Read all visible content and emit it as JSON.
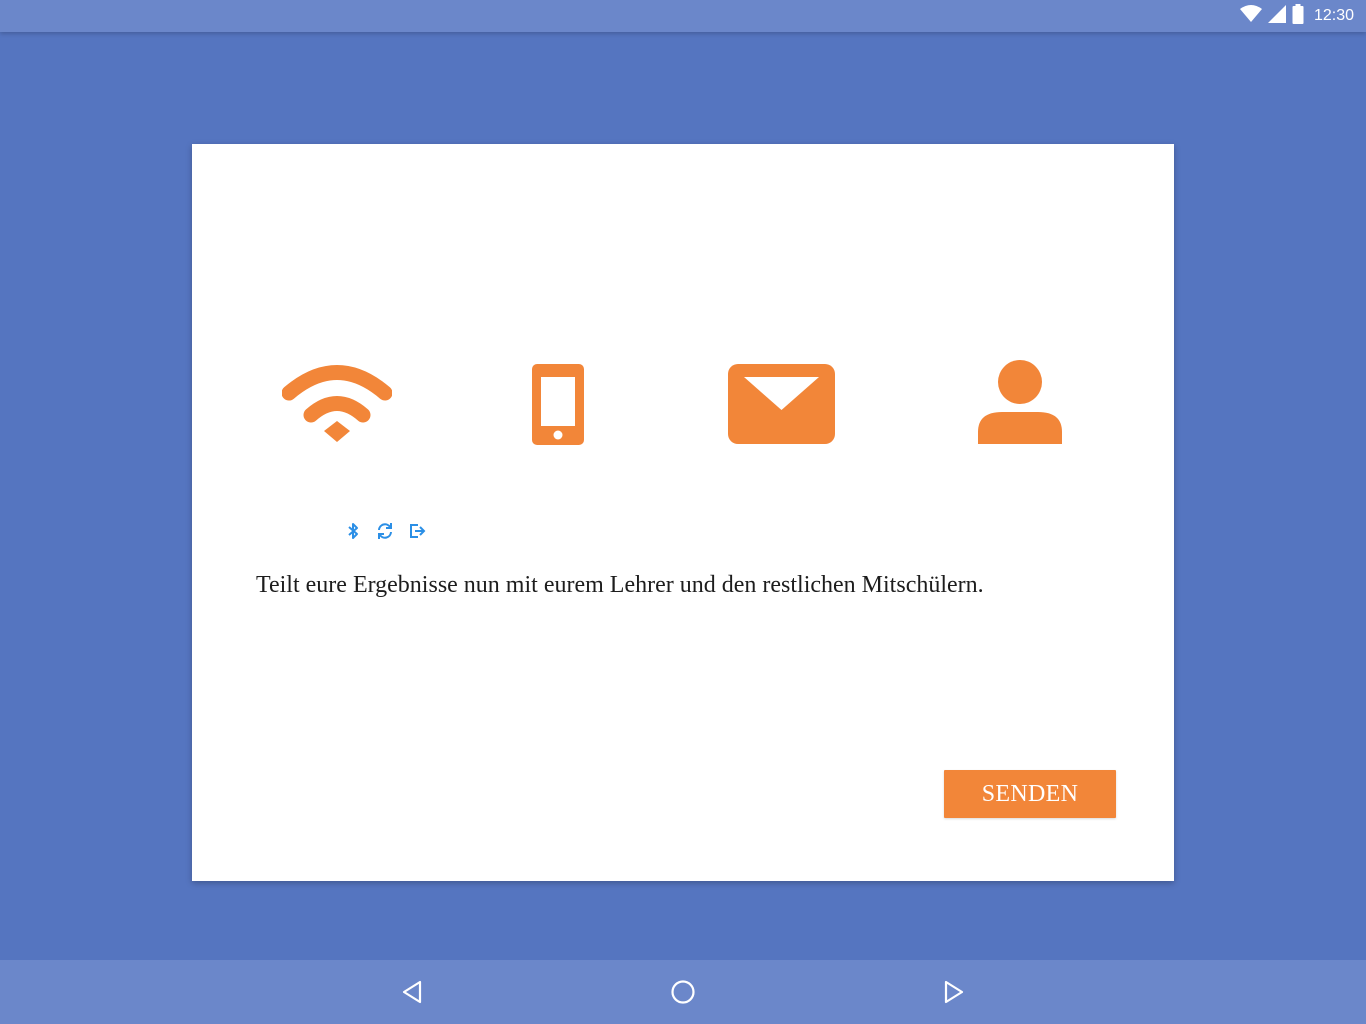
{
  "status_bar": {
    "time": "12:30",
    "icons": [
      "wifi-icon",
      "cell-signal-icon",
      "battery-icon"
    ]
  },
  "card": {
    "share_icons": [
      "wifi-icon",
      "smartphone-icon",
      "mail-icon",
      "person-icon"
    ],
    "mini_icons": [
      "bluetooth-icon",
      "sync-icon",
      "export-icon"
    ],
    "message": "Teilt eure Ergebnisse nun mit eurem Lehrer und den restlichen Mitschülern.",
    "send_label": "SENDEN"
  },
  "nav_bar": {
    "buttons": [
      "back-icon",
      "home-icon",
      "recents-icon"
    ]
  },
  "colors": {
    "background": "#5575c0",
    "bars": "#6b87ca",
    "accent": "#f28639",
    "mini_icon": "#2b8fe6"
  }
}
